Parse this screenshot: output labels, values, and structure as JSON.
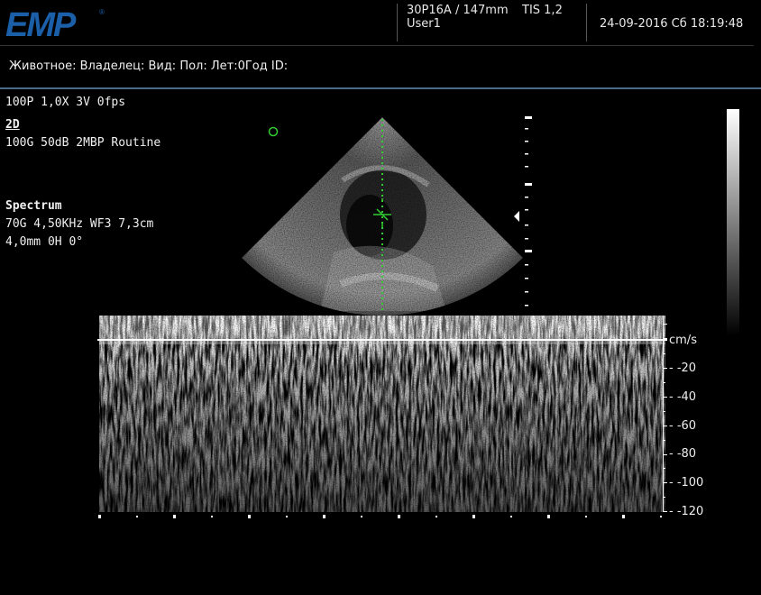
{
  "header": {
    "brand": "EMP",
    "probe": "30P16A / 147mm",
    "tis": "TIS   1,2",
    "user": "User1",
    "datetime": "24-09-2016 Сб 18:19:48"
  },
  "patient_bar": {
    "label": "Животное: Владелец: Вид: Пол: Лет:0Год ID:"
  },
  "params": {
    "line1": "100P 1,0X  3V   0fps",
    "mode_2d": "2D",
    "line_2d": "100G 50dB 2MBP Routine",
    "spectrum_title": "Spectrum",
    "spectrum_line1": "70G 4,50KHz WF3 7,3cm",
    "spectrum_line2": "4,0mm 0H  0°"
  },
  "doppler_scale": {
    "unit": "cm/s",
    "ticks": [
      "-20",
      "-40",
      "-60",
      "-80",
      "-100",
      "-120"
    ]
  },
  "colors": {
    "logo_blue": "#1a5fa8",
    "doppler_gate": "#33cc33",
    "divider": "#4a6a8a"
  }
}
